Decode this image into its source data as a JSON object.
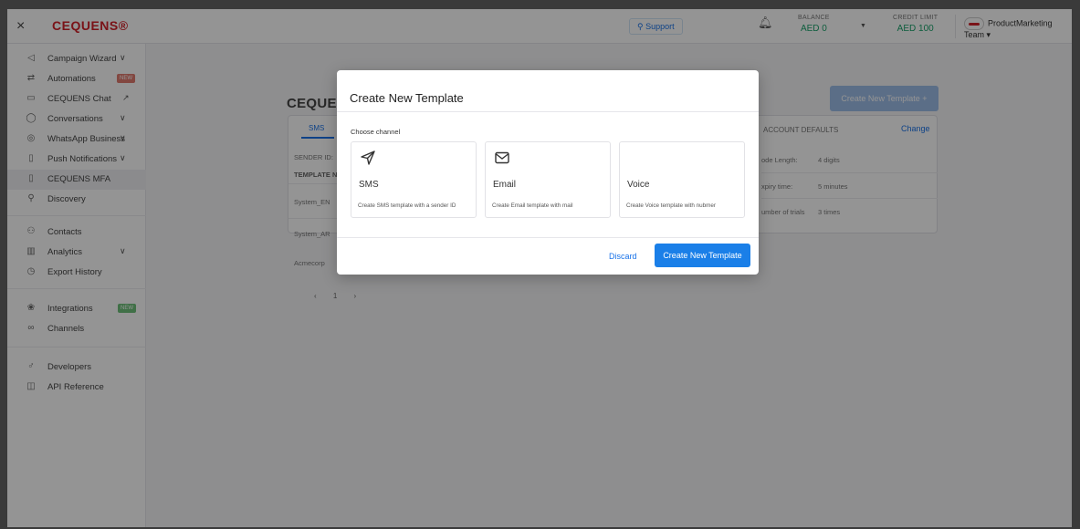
{
  "topbar": {
    "close": "×",
    "logo": "CEQUENS®",
    "support": "Support",
    "balance_label": "BALANCE",
    "balance_value": "AED 0",
    "credit_label": "CREDIT LIMIT",
    "credit_value": "AED 100",
    "team": "ProductMarketing Team"
  },
  "sidebar": {
    "items": [
      {
        "label": "Campaign Wizard",
        "icon": "megaphone-icon"
      },
      {
        "label": "Automations",
        "icon": "automation-icon",
        "badge": "NEW"
      },
      {
        "label": "CEQUENS Chat",
        "icon": "chat-icon"
      },
      {
        "label": "Conversations",
        "icon": "conversation-icon"
      },
      {
        "label": "WhatsApp Business",
        "icon": "whatsapp-icon"
      },
      {
        "label": "Push Notifications",
        "icon": "push-icon"
      },
      {
        "label": "CEQUENS MFA",
        "icon": "mfa-icon"
      },
      {
        "label": "Discovery",
        "icon": "search-icon"
      },
      {
        "label": "Contacts",
        "icon": "contacts-icon"
      },
      {
        "label": "Analytics",
        "icon": "analytics-icon"
      },
      {
        "label": "Export History",
        "icon": "history-icon"
      },
      {
        "label": "Integrations",
        "icon": "integrations-icon",
        "badge": "NEW"
      },
      {
        "label": "Channels",
        "icon": "channels-icon"
      },
      {
        "label": "Developers",
        "icon": "developers-icon"
      },
      {
        "label": "API Reference",
        "icon": "book-icon"
      }
    ]
  },
  "background": {
    "page_title": "CEQUEI",
    "create_button": "Create New Template +",
    "tab_sms": "SMS",
    "sender_id": "SENDER ID:",
    "template_header": "TEMPLATE N",
    "rows": [
      "System_EN",
      "System_AR",
      "Acmecorp"
    ],
    "account_defaults": "ACCOUNT DEFAULTS",
    "change": "Change",
    "defaults": [
      {
        "label": "ode Length:",
        "value": "4 digits"
      },
      {
        "label": "xpiry time:",
        "value": "5 minutes"
      },
      {
        "label": "umber of trials",
        "value": "3 times"
      }
    ],
    "pager": "‹ 1 ›"
  },
  "modal": {
    "title": "Create New Template",
    "choose_channel": "Choose channel",
    "channels": [
      {
        "name": "SMS",
        "desc": "Create SMS template with a sender ID",
        "icon": "send-icon"
      },
      {
        "name": "Email",
        "desc": "Create Email template with mail",
        "icon": "mail-icon"
      },
      {
        "name": "Voice",
        "desc": "Create Voice template with nubmer",
        "icon": ""
      }
    ],
    "discard": "Discard",
    "create": "Create New Template"
  }
}
